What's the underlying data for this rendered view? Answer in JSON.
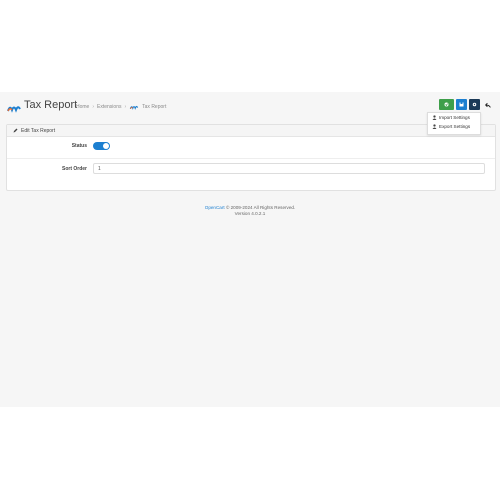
{
  "header": {
    "title": "Tax Report",
    "breadcrumbs": [
      "Home",
      "Extensions",
      "Tax Report"
    ],
    "separator": "›"
  },
  "dropdown": {
    "items": [
      {
        "label": "Import Settings",
        "icon": "user-icon"
      },
      {
        "label": "Export Settings",
        "icon": "user-icon"
      }
    ]
  },
  "card": {
    "title": "Edit Tax Report",
    "status_label": "Status",
    "status_on": true,
    "sort_order_label": "Sort Order",
    "sort_order_value": "1"
  },
  "footer": {
    "brand": "OpenCart",
    "copyright": "© 2009-2024 All Rights Reserved.",
    "version": "Version 4.0.2.1"
  },
  "colors": {
    "accent": "#1c7fd0",
    "green": "#3e9f4a",
    "dark": "#1b3a57"
  }
}
